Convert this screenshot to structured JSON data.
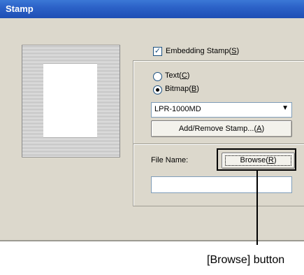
{
  "window": {
    "title": "Stamp"
  },
  "embedding_stamp": {
    "label": "Embedding Stamp(",
    "hotkey": "S",
    "suffix": ")",
    "checked": true
  },
  "radio_text": {
    "label": "Text(",
    "hotkey": "C",
    "suffix": ")",
    "selected": false
  },
  "radio_bitmap": {
    "label": "Bitmap(",
    "hotkey": "B",
    "suffix": ")",
    "selected": true
  },
  "stamp_select": {
    "value": "LPR-1000MD"
  },
  "add_remove_button": {
    "label": "Add/Remove Stamp...(",
    "hotkey": "A",
    "suffix": ")"
  },
  "file_name": {
    "label": "File Name:",
    "value": ""
  },
  "browse_button": {
    "label": "Browse(",
    "hotkey": "R",
    "suffix": ")"
  },
  "callout": {
    "text": "[Browse] button"
  }
}
